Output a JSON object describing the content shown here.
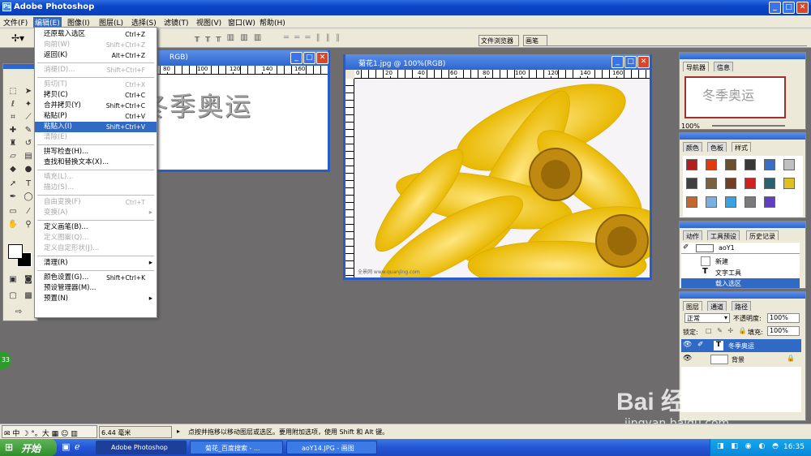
{
  "window": {
    "title": "Adobe Photoshop",
    "buttons": {
      "min": "_",
      "max": "□",
      "close": "✕"
    }
  },
  "menubar": [
    "文件(F)",
    "编辑(E)",
    "图像(I)",
    "图层(L)",
    "选择(S)",
    "滤镜(T)",
    "视图(V)",
    "窗口(W)",
    "帮助(H)"
  ],
  "options": {
    "right_tabs": [
      "文件浏览器",
      "画笔"
    ]
  },
  "edit_menu": [
    {
      "label": "还原载入选区",
      "shortcut": "Ctrl+Z",
      "state": "normal"
    },
    {
      "label": "向前(W)",
      "shortcut": "Shift+Ctrl+Z",
      "state": "disabled"
    },
    {
      "label": "返回(K)",
      "shortcut": "Alt+Ctrl+Z",
      "state": "normal"
    },
    {
      "sep": true
    },
    {
      "label": "消褪(D)...",
      "shortcut": "Shift+Ctrl+F",
      "state": "disabled"
    },
    {
      "sep": true
    },
    {
      "label": "剪切(T)",
      "shortcut": "Ctrl+X",
      "state": "disabled"
    },
    {
      "label": "拷贝(C)",
      "shortcut": "Ctrl+C",
      "state": "normal"
    },
    {
      "label": "合并拷贝(Y)",
      "shortcut": "Shift+Ctrl+C",
      "state": "normal"
    },
    {
      "label": "粘贴(P)",
      "shortcut": "Ctrl+V",
      "state": "normal"
    },
    {
      "label": "粘贴入(I)",
      "shortcut": "Shift+Ctrl+V",
      "state": "selected"
    },
    {
      "label": "清除(E)",
      "shortcut": "",
      "state": "disabled"
    },
    {
      "sep": true
    },
    {
      "label": "拼写检查(H)...",
      "shortcut": "",
      "state": "normal"
    },
    {
      "label": "查找和替换文本(X)...",
      "shortcut": "",
      "state": "normal"
    },
    {
      "sep": true
    },
    {
      "label": "填充(L)...",
      "shortcut": "",
      "state": "disabled"
    },
    {
      "label": "描边(S)...",
      "shortcut": "",
      "state": "disabled"
    },
    {
      "sep": true
    },
    {
      "label": "自由变换(F)",
      "shortcut": "Ctrl+T",
      "state": "disabled"
    },
    {
      "label": "变换(A)",
      "shortcut": "",
      "state": "disabled",
      "submenu": true
    },
    {
      "sep": true
    },
    {
      "label": "定义画笔(B)...",
      "shortcut": "",
      "state": "normal"
    },
    {
      "label": "定义图案(Q)...",
      "shortcut": "",
      "state": "disabled"
    },
    {
      "label": "定义自定形状(J)...",
      "shortcut": "",
      "state": "disabled"
    },
    {
      "sep": true
    },
    {
      "label": "清理(R)",
      "shortcut": "",
      "state": "normal",
      "submenu": true
    },
    {
      "sep": true
    },
    {
      "label": "颜色设置(G)...",
      "shortcut": "Shift+Ctrl+K",
      "state": "normal"
    },
    {
      "label": "预设管理器(M)...",
      "shortcut": "",
      "state": "normal"
    },
    {
      "label": "预置(N)",
      "shortcut": "",
      "state": "normal",
      "submenu": true
    }
  ],
  "doc1": {
    "title": "RGB)",
    "text": "冬季奥运",
    "ruler": [
      "80",
      "100",
      "120",
      "140",
      "160"
    ]
  },
  "doc2": {
    "title": "菊花1.jpg @ 100%(RGB)",
    "ruler": [
      "0",
      "20",
      "40",
      "60",
      "80",
      "100",
      "120",
      "140",
      "160"
    ],
    "watermark": "全景网 www.quanjing.com"
  },
  "navigator": {
    "tabs": [
      "导航器",
      "信息"
    ],
    "thumb_text": "冬季奥运",
    "zoom": "100%"
  },
  "styles": {
    "tabs": [
      "颜色",
      "色板",
      "样式"
    ],
    "colors": [
      "#b02020",
      "#e03a10",
      "#6b5030",
      "#383838",
      "#3a6ec0",
      "#c0c0c0",
      "#404040",
      "#7a6040",
      "#704020",
      "#d02020",
      "#2a6070",
      "#e0c020",
      "#c06830",
      "#7ab0e0",
      "#3aa0e0",
      "#7a7a7a",
      "#6040c0"
    ]
  },
  "history": {
    "tabs": [
      "动作",
      "工具预设",
      "历史记录"
    ],
    "snapshot": "aoY1",
    "items": [
      "新建",
      "文字工具",
      "载入选区"
    ]
  },
  "layers": {
    "tabs": [
      "图层",
      "通道",
      "路径"
    ],
    "blend": "正常",
    "opacity_label": "不透明度:",
    "opacity": "100%",
    "lock_label": "锁定:",
    "fill_label": "填充:",
    "fill": "100%",
    "items": [
      "冬季奥运",
      "背景"
    ]
  },
  "status": {
    "zoom": "6.44 毫米",
    "ime": "中",
    "hint": "点按并拖移以移动图层或选区。要用附加选项，使用 Shift 和 Alt 键。",
    "badge": "33"
  },
  "taskbar": {
    "start": "开始",
    "tasks": [
      "Adobe Photoshop",
      "菊花_百度搜索 - ...",
      "aoY14.JPG - 画图"
    ],
    "time": "16:35"
  },
  "watermark": {
    "brand": "Bai  经验",
    "url": "jingyan.baidu.com"
  }
}
